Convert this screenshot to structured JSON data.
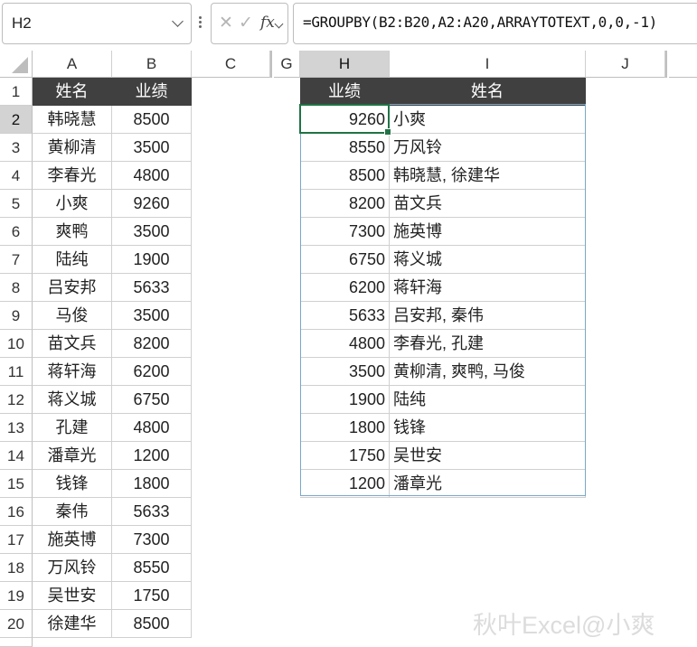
{
  "formula_bar": {
    "name_box": "H2",
    "formula": "=GROUPBY(B2:B20,A2:A20,ARRAYTOTEXT,0,0,-1)",
    "cancel_icon": "close-icon",
    "enter_icon": "check-icon",
    "fx_label": "fx"
  },
  "columns": [
    "A",
    "B",
    "C",
    "G",
    "H",
    "I",
    "J"
  ],
  "rows": [
    "1",
    "2",
    "3",
    "4",
    "5",
    "6",
    "7",
    "8",
    "9",
    "10",
    "11",
    "12",
    "13",
    "14",
    "15",
    "16",
    "17",
    "18",
    "19",
    "20"
  ],
  "source_table": {
    "headers": [
      "姓名",
      "业绩"
    ],
    "rows": [
      [
        "韩晓慧",
        "8500"
      ],
      [
        "黄柳清",
        "3500"
      ],
      [
        "李春光",
        "4800"
      ],
      [
        "小爽",
        "9260"
      ],
      [
        "爽鸭",
        "3500"
      ],
      [
        "陆纯",
        "1900"
      ],
      [
        "吕安邦",
        "5633"
      ],
      [
        "马俊",
        "3500"
      ],
      [
        "苗文兵",
        "8200"
      ],
      [
        "蒋轩海",
        "6200"
      ],
      [
        "蒋义城",
        "6750"
      ],
      [
        "孔建",
        "4800"
      ],
      [
        "潘章光",
        "1200"
      ],
      [
        "钱锋",
        "1800"
      ],
      [
        "秦伟",
        "5633"
      ],
      [
        "施英博",
        "7300"
      ],
      [
        "万风铃",
        "8550"
      ],
      [
        "吴世安",
        "1750"
      ],
      [
        "徐建华",
        "8500"
      ]
    ]
  },
  "result_table": {
    "headers": [
      "业绩",
      "姓名"
    ],
    "rows": [
      [
        "9260",
        "小爽"
      ],
      [
        "8550",
        "万风铃"
      ],
      [
        "8500",
        "韩晓慧, 徐建华"
      ],
      [
        "8200",
        "苗文兵"
      ],
      [
        "7300",
        "施英博"
      ],
      [
        "6750",
        "蒋义城"
      ],
      [
        "6200",
        "蒋轩海"
      ],
      [
        "5633",
        "吕安邦, 秦伟"
      ],
      [
        "4800",
        "李春光, 孔建"
      ],
      [
        "3500",
        "黄柳清, 爽鸭, 马俊"
      ],
      [
        "1900",
        "陆纯"
      ],
      [
        "1800",
        "钱锋"
      ],
      [
        "1750",
        "吴世安"
      ],
      [
        "1200",
        "潘章光"
      ]
    ]
  },
  "selected_cell": "H2",
  "watermark": "秋叶Excel@小爽"
}
